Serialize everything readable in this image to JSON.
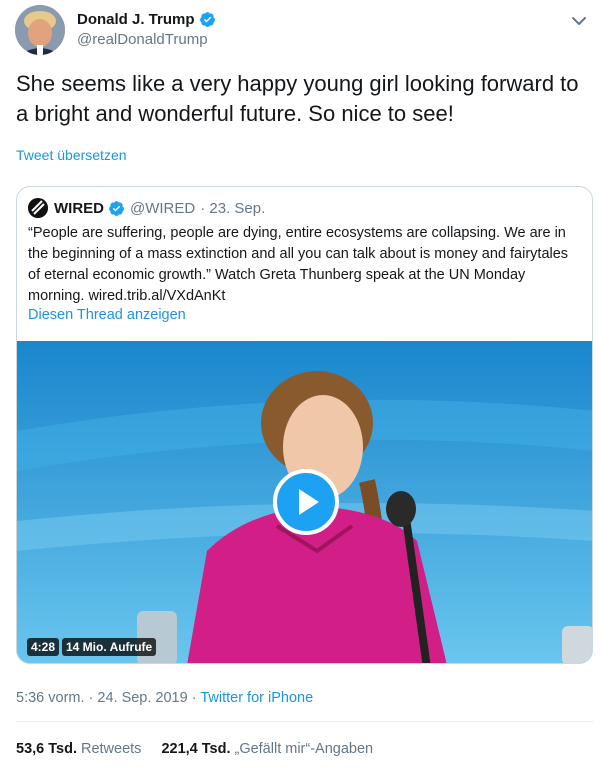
{
  "author": {
    "name": "Donald J. Trump",
    "handle": "@realDonaldTrump"
  },
  "tweet": {
    "text": "She seems like a very happy young girl looking forward to a bright and wonderful future. So nice to see!",
    "translate_label": "Tweet übersetzen"
  },
  "quoted": {
    "name": "WIRED",
    "handle": "@WIRED",
    "date": "· 23. Sep.",
    "text": "“People are suffering, people are dying, entire ecosystems are collapsing. We are in the beginning of a mass extinction and all you can talk about is money and fairytales of eternal economic growth.” Watch Greta Thunberg speak at the UN Monday morning. wired.trib.al/VXdAnKt",
    "show_thread_label": "Diesen Thread anzeigen",
    "video": {
      "duration": "4:28",
      "views": "14 Mio. Aufrufe"
    }
  },
  "meta": {
    "timestamp": "5:36 vorm. · 24. Sep. 2019 ·",
    "source": "Twitter for iPhone"
  },
  "stats": {
    "retweets_count": "53,6 Tsd.",
    "retweets_label": "Retweets",
    "likes_count": "221,4 Tsd.",
    "likes_label": "„Gefällt mir“-Angaben"
  },
  "colors": {
    "accent": "#1b95e0",
    "play": "#1da1f2",
    "secondary_text": "#657786",
    "border": "#ccd6dd"
  },
  "icons": {
    "verified": "verified-badge-icon",
    "more": "chevron-down-icon",
    "play": "play-icon"
  }
}
